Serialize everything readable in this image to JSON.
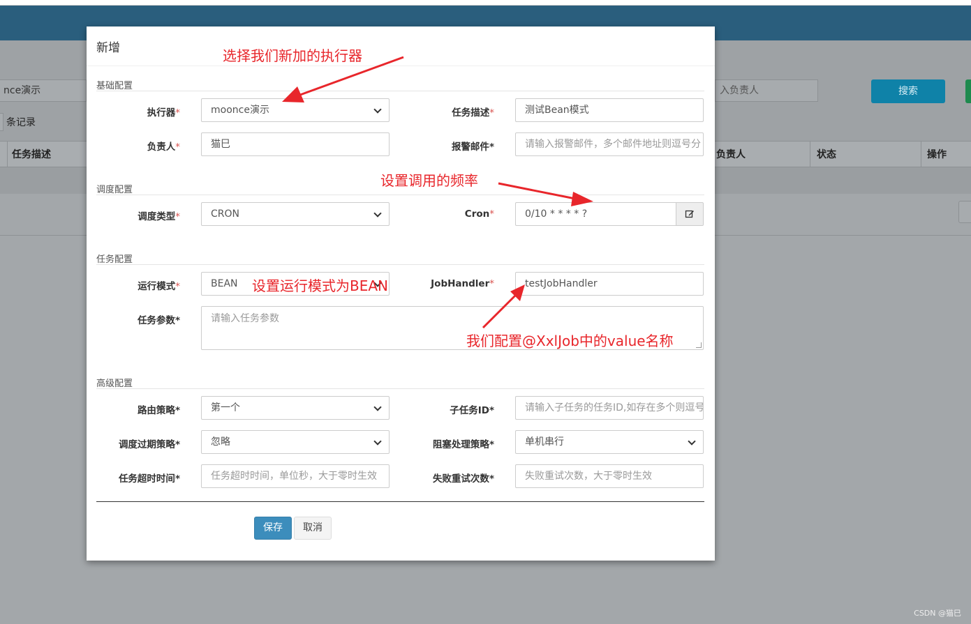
{
  "background": {
    "executor_filter_value": "nce演示",
    "owner_filter_placeholder": "入负责人",
    "search_button": "搜索",
    "records_label": "条记录",
    "columns": [
      "任务描述",
      "负责人",
      "状态",
      "操作"
    ],
    "watermark": "CSDN @猫巳"
  },
  "modal": {
    "title": "新增",
    "sections": {
      "basic": "基础配置",
      "schedule": "调度配置",
      "task": "任务配置",
      "advanced": "高级配置"
    },
    "fields": {
      "executor": {
        "label": "执行器",
        "value": "moonce演示"
      },
      "job_desc": {
        "label": "任务描述",
        "value": "测试Bean模式"
      },
      "author": {
        "label": "负责人",
        "value": "猫巳"
      },
      "alarm_email": {
        "label": "报警邮件",
        "placeholder": "请输入报警邮件，多个邮件地址则逗号分"
      },
      "schedule_type": {
        "label": "调度类型",
        "value": "CRON"
      },
      "cron": {
        "label": "Cron",
        "value": "0/10 * * * * ?"
      },
      "glue_type": {
        "label": "运行模式",
        "value": "BEAN"
      },
      "job_handler": {
        "label": "JobHandler",
        "value": "testJobHandler"
      },
      "job_param": {
        "label": "任务参数",
        "placeholder": "请输入任务参数"
      },
      "route_strategy": {
        "label": "路由策略",
        "value": "第一个"
      },
      "child_job_id": {
        "label": "子任务ID",
        "placeholder": "请输入子任务的任务ID,如存在多个则逗号分隔"
      },
      "misfire_strategy": {
        "label": "调度过期策略",
        "value": "忽略"
      },
      "block_strategy": {
        "label": "阻塞处理策略",
        "value": "单机串行"
      },
      "timeout": {
        "label": "任务超时时间",
        "placeholder": "任务超时时间，单位秒，大于零时生效"
      },
      "fail_retry": {
        "label": "失败重试次数",
        "placeholder": "失败重试次数，大于零时生效"
      }
    },
    "required_mark": "*",
    "save_button": "保存",
    "cancel_button": "取消"
  },
  "annotations": {
    "executor_note": "选择我们新加的执行器",
    "cron_note": "设置调用的频率",
    "mode_note": "设置运行模式为BEAN",
    "handler_note": "我们配置@XxlJob中的value名称"
  },
  "colors": {
    "header": "#2a5e7d",
    "primary": "#3c8dbc",
    "annotation": "#e8262b",
    "required": "#d9534f"
  }
}
